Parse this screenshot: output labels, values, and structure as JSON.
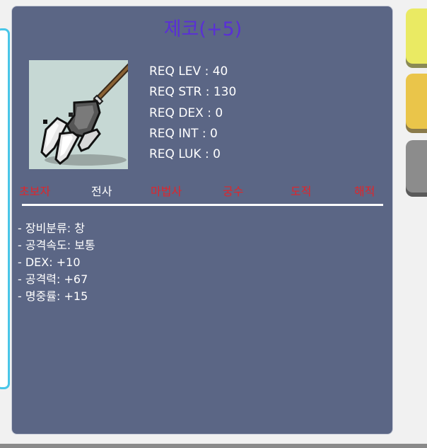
{
  "item": {
    "title": "제코(+5)",
    "icon": "polearm-trident-icon"
  },
  "requirements": [
    "REQ LEV : 40",
    "REQ STR : 130",
    "REQ DEX : 0",
    "REQ INT : 0",
    "REQ LUK : 0"
  ],
  "jobs": [
    {
      "label": "초보자",
      "allowed": false
    },
    {
      "label": "전사",
      "allowed": true
    },
    {
      "label": "마법사",
      "allowed": false
    },
    {
      "label": "궁수",
      "allowed": false
    },
    {
      "label": "도적",
      "allowed": false
    },
    {
      "label": "해적",
      "allowed": false
    }
  ],
  "stats": [
    "- 장비분류: 창",
    "- 공격속도: 보통",
    "- DEX: +10",
    "- 공격력: +67",
    "- 명중률: +15"
  ],
  "colors": {
    "card_bg": "#5b6685",
    "title": "#5a2fd6",
    "job_allowed": "#ffffff",
    "job_denied": "#e0252b",
    "icon_bg": "#c6d8d4"
  }
}
